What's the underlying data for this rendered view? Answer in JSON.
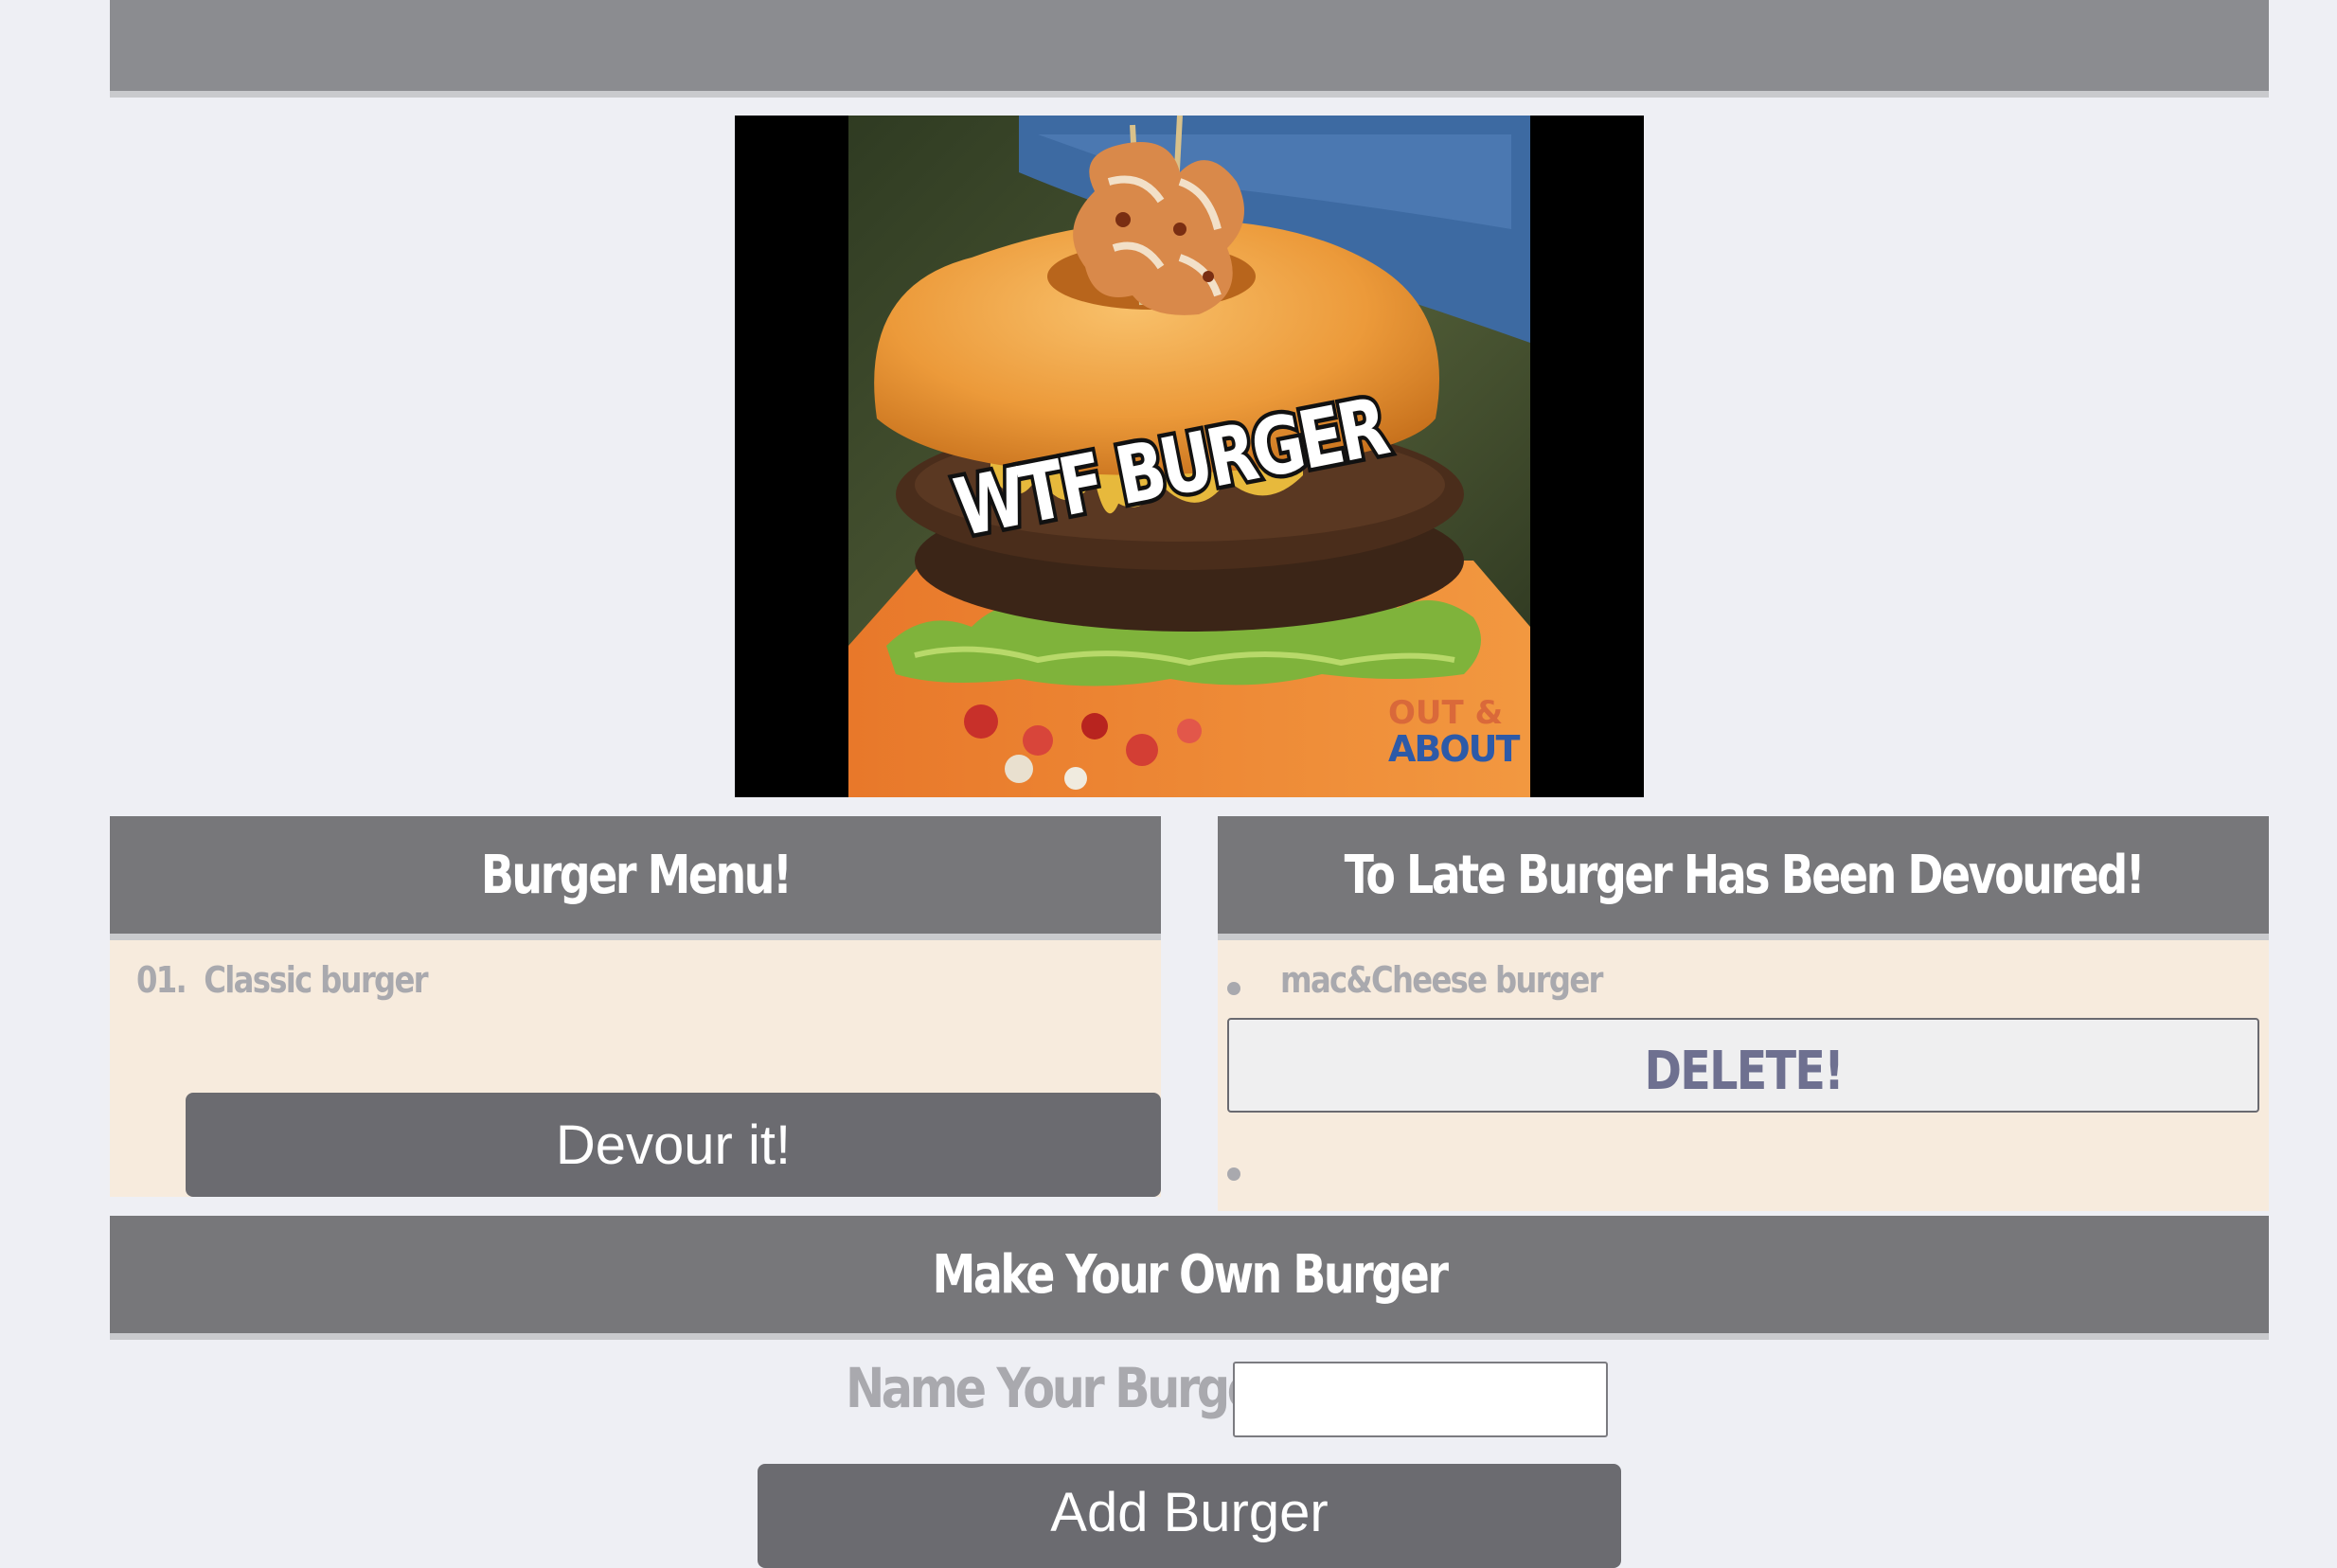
{
  "hero": {
    "image_text": "WTF BURGER",
    "watermark_line1": "OUT &",
    "watermark_line2": "ABOUT"
  },
  "menu_panel": {
    "title": "Burger Menu!",
    "items": [
      {
        "number": "01.",
        "name": "Classic burger"
      }
    ],
    "devour_label": "Devour it!"
  },
  "devoured_panel": {
    "title": "To Late Burger Has Been Devoured!",
    "items": [
      {
        "name": "mac&Cheese burger"
      }
    ],
    "delete_label": "DELETE!"
  },
  "make_burger": {
    "title": "Make Your Own Burger",
    "name_label": "Name Your Burger:",
    "name_value": "",
    "add_label": "Add Burger"
  },
  "colors": {
    "header_bg": "#77777a",
    "panel_bg": "#f7ebdd",
    "button_bg": "#6b6b70",
    "page_bg": "#eeeff4"
  }
}
